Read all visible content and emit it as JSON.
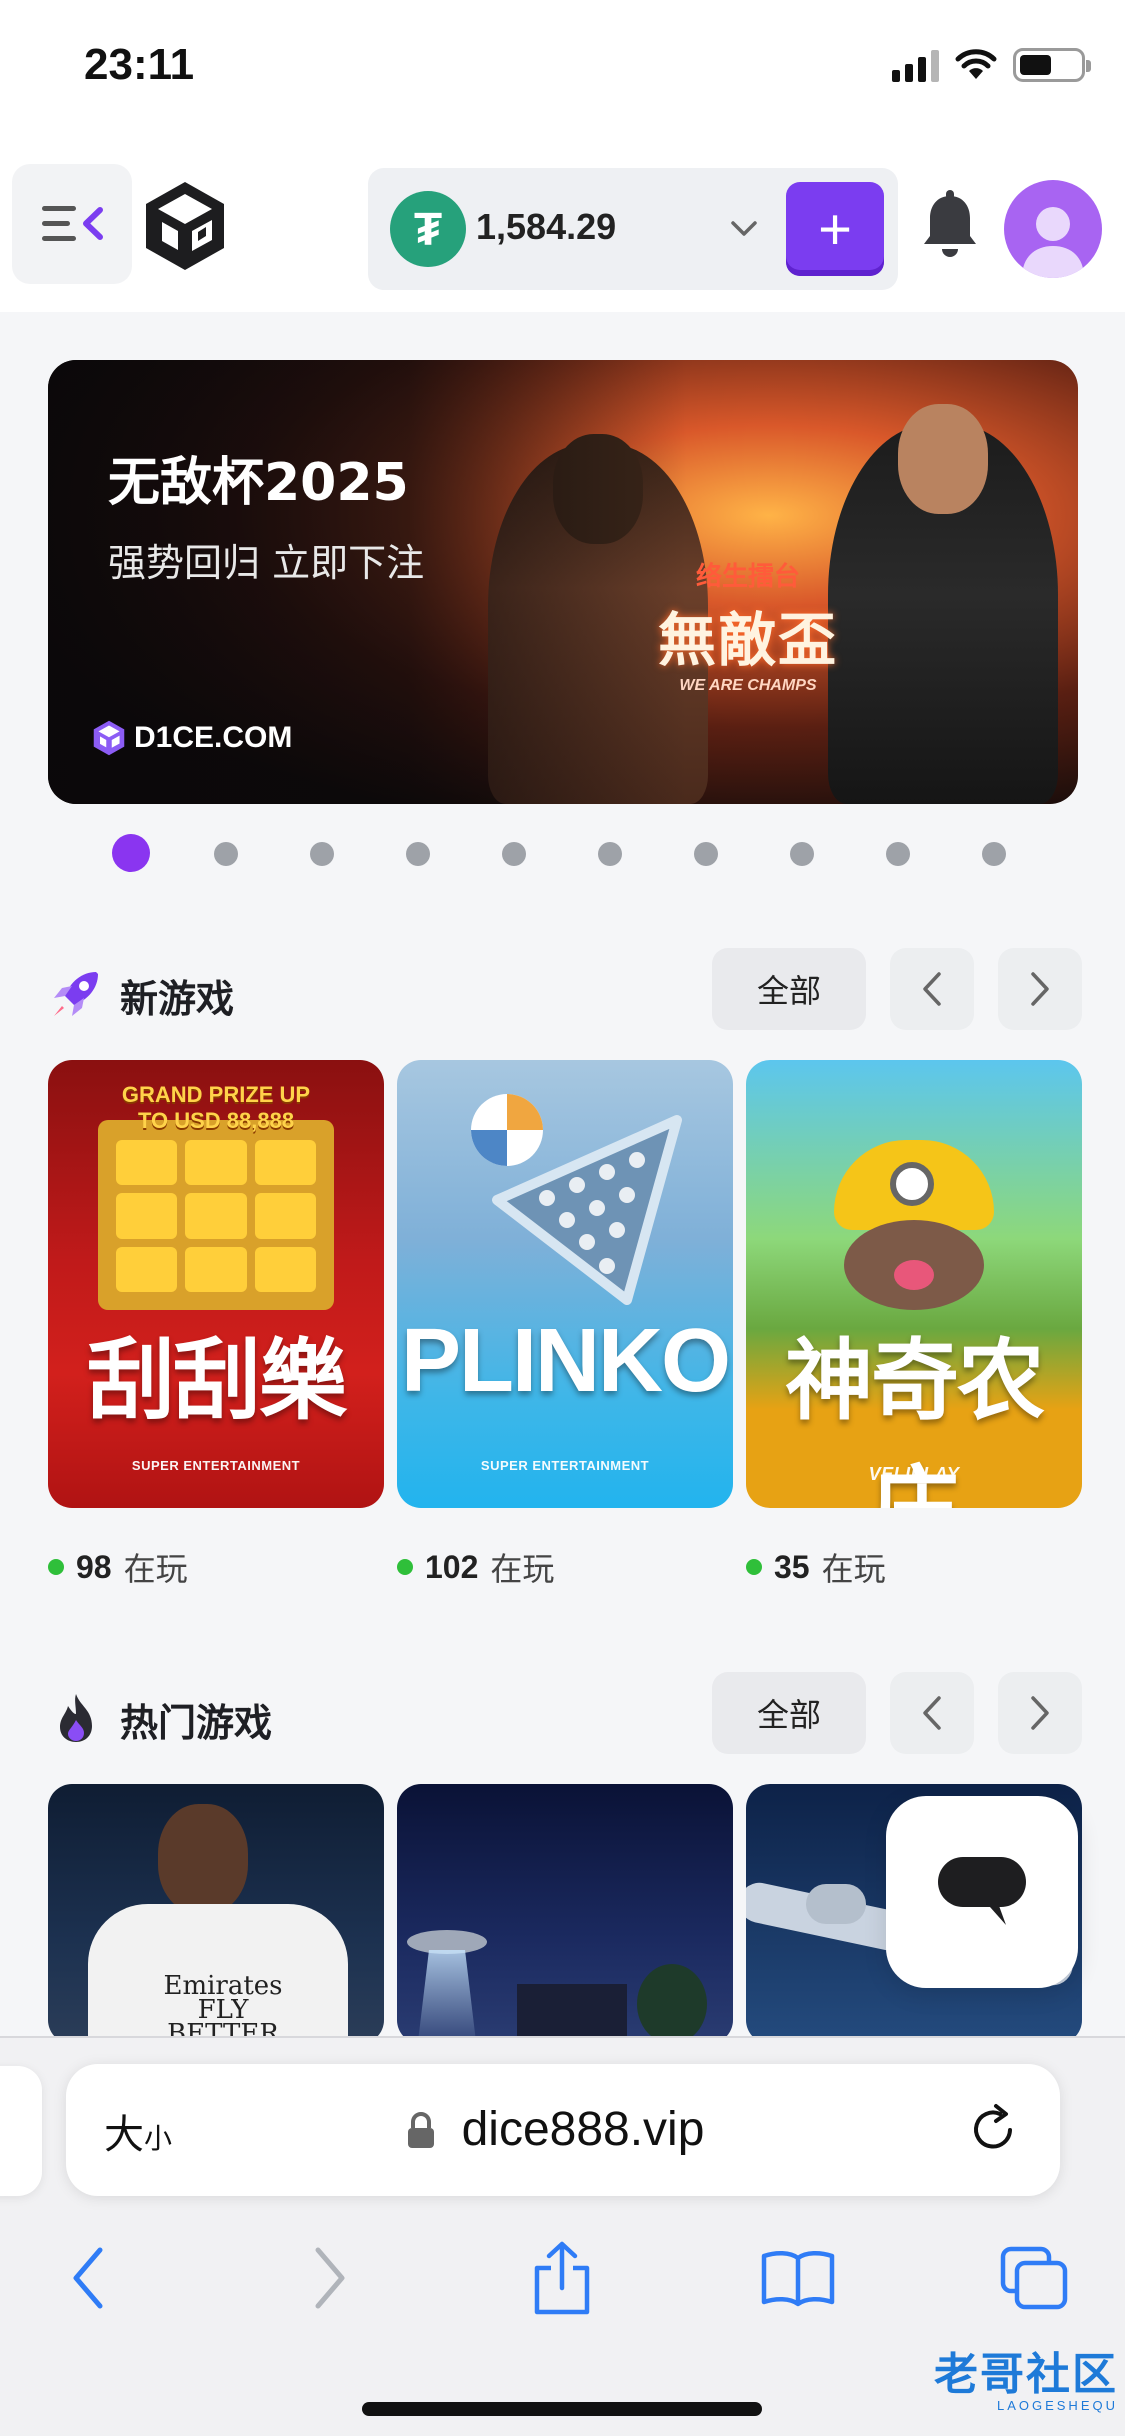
{
  "status_bar": {
    "time": "23:11",
    "battery_level": 0.54
  },
  "header": {
    "balance": "1,584.29",
    "currency_icon": "tether-icon",
    "deposit_label": "+"
  },
  "banner": {
    "title": "无敌杯2025",
    "subtitle": "强势回归 立即下注",
    "badge_top": "络生擂台",
    "badge_main": "無敵盃",
    "badge_bottom": "WE ARE CHAMPS",
    "brand": "D1CE.COM",
    "dot_count": 10,
    "active_dot": 0
  },
  "sections": {
    "new_games": {
      "title": "新游戏",
      "all_label": "全部",
      "games": [
        {
          "name": "刮刮樂",
          "provider": "SUPER ENTERTAINMENT",
          "banner_text": "GRAND PRIZE UP TO USD 88,888",
          "players": "98",
          "players_label": "在玩"
        },
        {
          "name": "PLINKO",
          "provider": "SUPER ENTERTAINMENT",
          "players": "102",
          "players_label": "在玩"
        },
        {
          "name": "神奇农庄",
          "provider": "VELIPLAY",
          "players": "35",
          "players_label": "在玩"
        }
      ]
    },
    "hot_games": {
      "title": "热门游戏",
      "all_label": "全部",
      "games": [
        {
          "jersey_text": "Emirates FLY BETTER"
        },
        {},
        {}
      ]
    }
  },
  "browser": {
    "text_size_label": "大",
    "text_size_small": "小",
    "url": "dice888.vip"
  },
  "watermark": {
    "main": "老哥社区",
    "sub": "LAOGESHEQU"
  },
  "colors": {
    "accent": "#7b3df0",
    "tether": "#26a17b",
    "live": "#2fbf3a",
    "avatar": "#a864f2"
  }
}
